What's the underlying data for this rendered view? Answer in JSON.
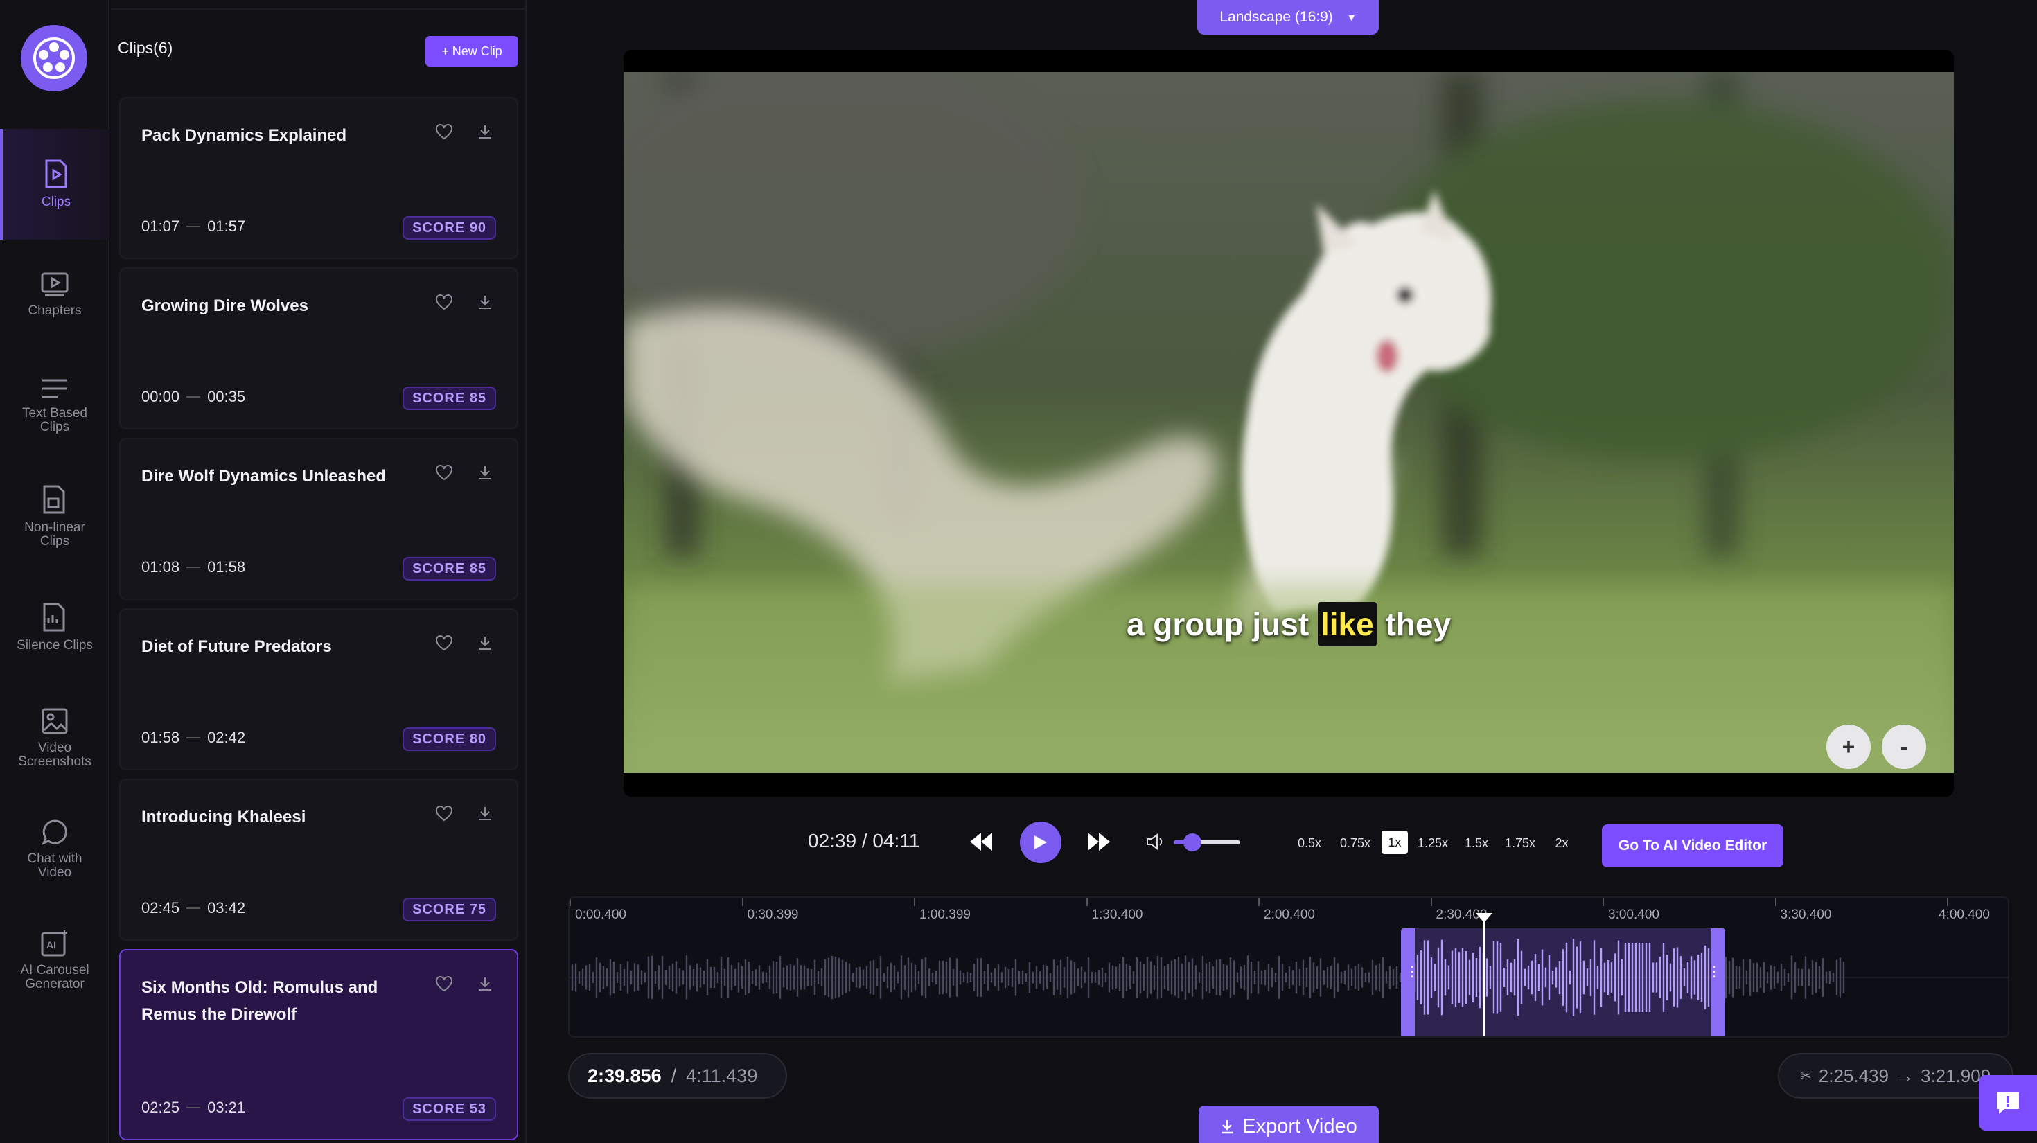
{
  "nav": {
    "items": [
      {
        "label": "Clips",
        "icon": "play-document-icon"
      },
      {
        "label": "Chapters",
        "icon": "chapters-icon"
      },
      {
        "label": "Text Based Clips",
        "icon": "text-lines-icon"
      },
      {
        "label": "Non-linear Clips",
        "icon": "nonlinear-icon"
      },
      {
        "label": "Silence Clips",
        "icon": "silence-icon"
      },
      {
        "label": "Video Screenshots",
        "icon": "image-icon"
      },
      {
        "label": "Chat with Video",
        "icon": "chat-icon"
      },
      {
        "label": "AI Carousel Generator",
        "icon": "ai-image-icon"
      }
    ]
  },
  "clips": {
    "title": "Clips(6)",
    "new_clip_label": "+ New Clip",
    "items": [
      {
        "title": "Pack Dynamics Explained",
        "start": "01:07",
        "end": "01:57",
        "score": "SCORE 90"
      },
      {
        "title": "Growing Dire Wolves",
        "start": "00:00",
        "end": "00:35",
        "score": "SCORE 85"
      },
      {
        "title": "Dire Wolf Dynamics Unleashed",
        "start": "01:08",
        "end": "01:58",
        "score": "SCORE 85"
      },
      {
        "title": "Diet of Future Predators",
        "start": "01:58",
        "end": "02:42",
        "score": "SCORE 80"
      },
      {
        "title": "Introducing Khaleesi",
        "start": "02:45",
        "end": "03:42",
        "score": "SCORE 75"
      },
      {
        "title": "Six Months Old: Romulus and Remus the Direwolf",
        "start": "02:25",
        "end": "03:21",
        "score": "SCORE 53"
      }
    ]
  },
  "player": {
    "aspect_label": "Landscape (16:9)",
    "caption_before": "a group just",
    "caption_highlight": "like",
    "caption_after": "they",
    "zoom_in": "+",
    "zoom_out": "-",
    "time_readout": "02:39 / 04:11",
    "volume_level": 0.28,
    "speeds": [
      "0.5x",
      "0.75x",
      "1x",
      "1.25x",
      "1.5x",
      "1.75x",
      "2x"
    ],
    "active_speed": "1x",
    "editor_button": "Go To AI Video Editor"
  },
  "timeline": {
    "ruler": [
      "0:00.400",
      "0:30.399",
      "1:00.399",
      "1:30.400",
      "2:00.400",
      "2:30.400",
      "3:00.400",
      "3:30.400",
      "4:00.400"
    ],
    "current_time": "2:39.856",
    "separator": "/",
    "total_time": "4:11.439",
    "range_start": "2:25.439",
    "range_end": "3:21.909"
  },
  "export_label": "Export Video",
  "colors": {
    "accent": "#7c5cf0",
    "score_text": "#b89bff",
    "caption_highlight": "#ffe84d"
  }
}
